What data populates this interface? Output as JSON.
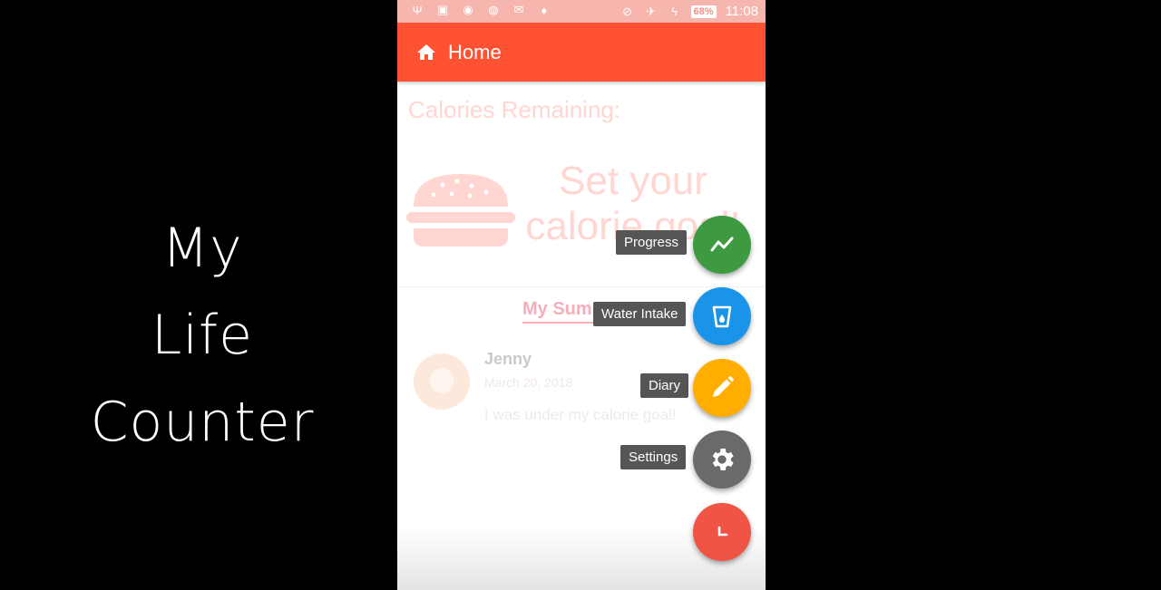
{
  "promo": {
    "line1": "My",
    "line2": "Life",
    "line3": "Counter"
  },
  "status_bar": {
    "battery": "68%",
    "time": "11:08"
  },
  "app_bar": {
    "title": "Home",
    "icon": "home-icon"
  },
  "content": {
    "calories_label": "Calories Remaining:",
    "goal_line1": "Set your",
    "goal_line2": "calorie goal!",
    "summary_tab": "My Summary",
    "post": {
      "name": "Jenny",
      "date": "March 20, 2018",
      "text": "I was under my calorie goal!"
    }
  },
  "fab_menu": {
    "progress": {
      "label": "Progress",
      "color": "#3d9a41",
      "icon": "trend-line-icon"
    },
    "water": {
      "label": "Water Intake",
      "color": "#1a94e8",
      "icon": "water-cup-icon"
    },
    "diary": {
      "label": "Diary",
      "color": "#ffae00",
      "icon": "pencil-icon"
    },
    "settings": {
      "label": "Settings",
      "color": "#6a6a6a",
      "icon": "gear-icon"
    },
    "main": {
      "color": "#f05445",
      "icon": "close-icon"
    }
  },
  "colors": {
    "accent": "#ff5233",
    "statusbar": "#f6b6ae"
  }
}
